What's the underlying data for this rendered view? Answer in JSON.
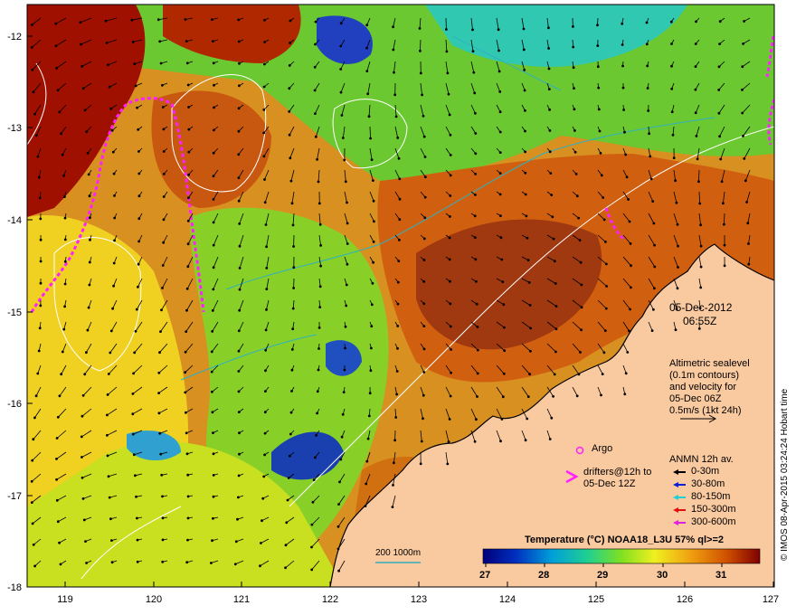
{
  "map": {
    "datetime_date": "05-Dec-2012",
    "datetime_time": "06:55Z",
    "credit": "© IMOS 08-Apr-2015 03:24:24 Hobart time",
    "lat_ticks": [
      "-12",
      "-13",
      "-14",
      "-15",
      "-16",
      "-17",
      "-18"
    ],
    "lon_ticks": [
      "119",
      "120",
      "121",
      "122",
      "123",
      "124",
      "125",
      "126",
      "127"
    ],
    "altimetry_text": [
      "Altimetric sealevel",
      "(0.1m contours)",
      "and velocity for",
      "05-Dec 06Z",
      "0.5m/s (1kt 24h)"
    ],
    "argo_label": "Argo",
    "drifters_text": [
      "drifters@12h to",
      "05-Dec 12Z"
    ],
    "anmn_title": "ANMN 12h av.",
    "anmn_entries": [
      {
        "label": "0-30m",
        "color": "#000000"
      },
      {
        "label": "30-80m",
        "color": "#1020d0"
      },
      {
        "label": "80-150m",
        "color": "#20d0d0"
      },
      {
        "label": "150-300m",
        "color": "#e01010"
      },
      {
        "label": "300-600m",
        "color": "#e020e0"
      }
    ],
    "bathy_label": "200  1000m",
    "colorbar_title": "Temperature (°C) NOAA18_L3U 57% ql>=2",
    "colorbar_ticks": [
      "27",
      "28",
      "29",
      "30",
      "31"
    ],
    "colors": {
      "land": "#f9c9a0",
      "warm": "#a01000",
      "cold": "#1030a0",
      "drifter": "#ff20ff",
      "contour": "#ffffff",
      "bathy": "#30b0c0"
    }
  }
}
